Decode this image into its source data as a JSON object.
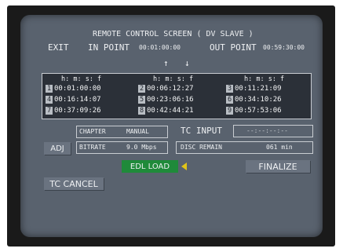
{
  "title": "REMOTE CONTROL SCREEN ( DV SLAVE )",
  "exit_label": "EXIT",
  "in_point": {
    "label": "IN POINT",
    "value": "00:01:00:00"
  },
  "out_point": {
    "label": "OUT POINT",
    "value": "00:59:30:00"
  },
  "arrows": {
    "up": "↑",
    "down": "↓"
  },
  "tc_header": "h: m: s: f",
  "tc_list": [
    {
      "num": "1",
      "value": "00:01:00:00"
    },
    {
      "num": "2",
      "value": "00:06:12:27"
    },
    {
      "num": "3",
      "value": "00:11:21:09"
    },
    {
      "num": "4",
      "value": "00:16:14:07"
    },
    {
      "num": "5",
      "value": "00:23:06:16"
    },
    {
      "num": "6",
      "value": "00:34:10:26"
    },
    {
      "num": "7",
      "value": "00:37:09:26"
    },
    {
      "num": "8",
      "value": "00:42:44:21"
    },
    {
      "num": "9",
      "value": "00:57:53:06"
    }
  ],
  "chapter": {
    "label": "CHAPTER",
    "value": "MANUAL"
  },
  "tc_input": {
    "label": "TC INPUT",
    "value": "--:--:--:--"
  },
  "adj_label": "ADJ",
  "bitrate": {
    "label": "BITRATE",
    "value": "9.0 Mbps"
  },
  "disc_remain": {
    "label": "DISC REMAIN",
    "value": "061 min"
  },
  "edl_load_label": "EDL LOAD",
  "finalize_label": "FINALIZE",
  "tc_cancel_label": "TC CANCEL",
  "colors": {
    "highlight": "#1f8a3a",
    "screen": "#59626e",
    "cursor": "#e0c419"
  }
}
